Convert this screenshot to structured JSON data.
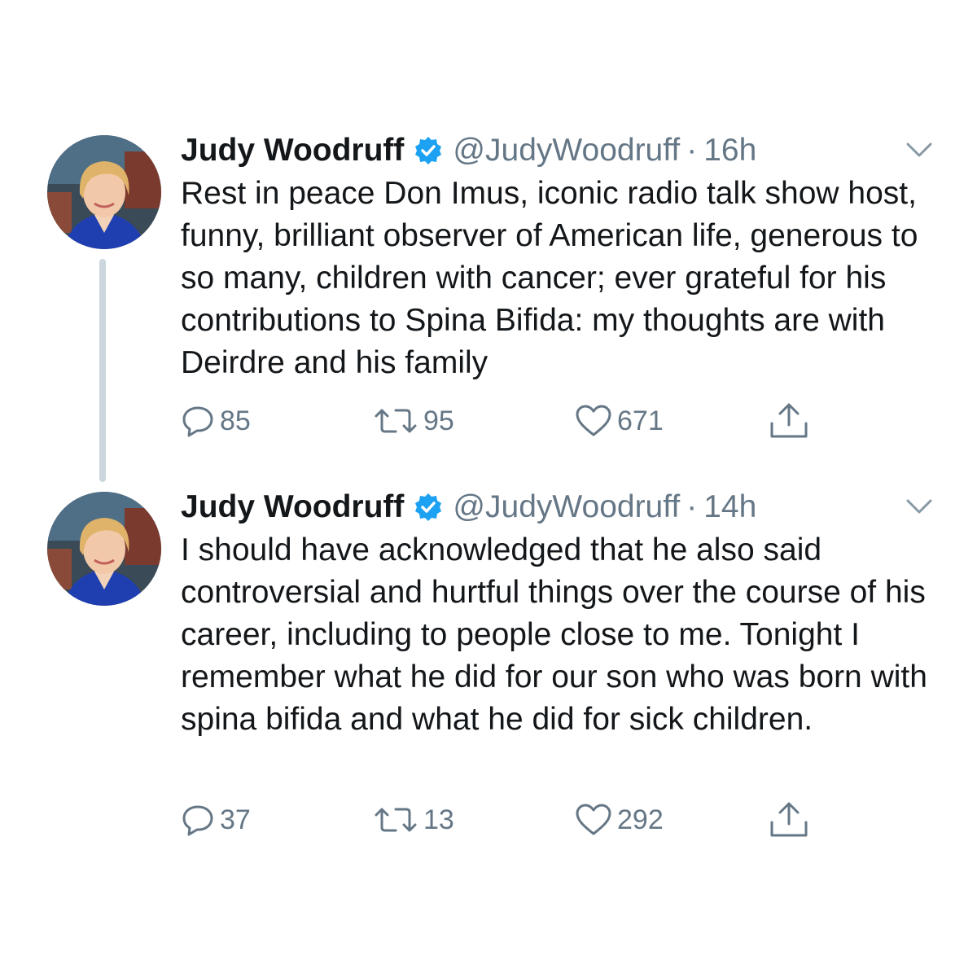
{
  "colors": {
    "text": "#14171a",
    "secondary": "#657786",
    "verified": "#1da1f2",
    "thread_line": "#ccd6dd",
    "background": "#ffffff"
  },
  "tweets": [
    {
      "author_name": "Judy Woodruff",
      "verified": true,
      "handle": "@JudyWoodruff",
      "separator": "·",
      "time": "16h",
      "text": "Rest in peace Don Imus, iconic radio talk show host, funny, brilliant observer of American life, generous to so many, children with cancer; ever grateful for his contributions to Spina Bifida: my thoughts are with Deirdre and his family",
      "replies": "85",
      "retweets": "95",
      "likes": "671",
      "icons": [
        "reply-icon",
        "retweet-icon",
        "like-icon",
        "share-icon",
        "caret-down-icon"
      ]
    },
    {
      "author_name": "Judy Woodruff",
      "verified": true,
      "handle": "@JudyWoodruff",
      "separator": "·",
      "time": "14h",
      "text": "I should have acknowledged that he also said controversial and hurtful things over the course of his career, including to people close to me. Tonight I remember what he did for our son who was born with spina bifida and what he did for sick children.",
      "replies": "37",
      "retweets": "13",
      "likes": "292",
      "icons": [
        "reply-icon",
        "retweet-icon",
        "like-icon",
        "share-icon",
        "caret-down-icon"
      ]
    }
  ]
}
